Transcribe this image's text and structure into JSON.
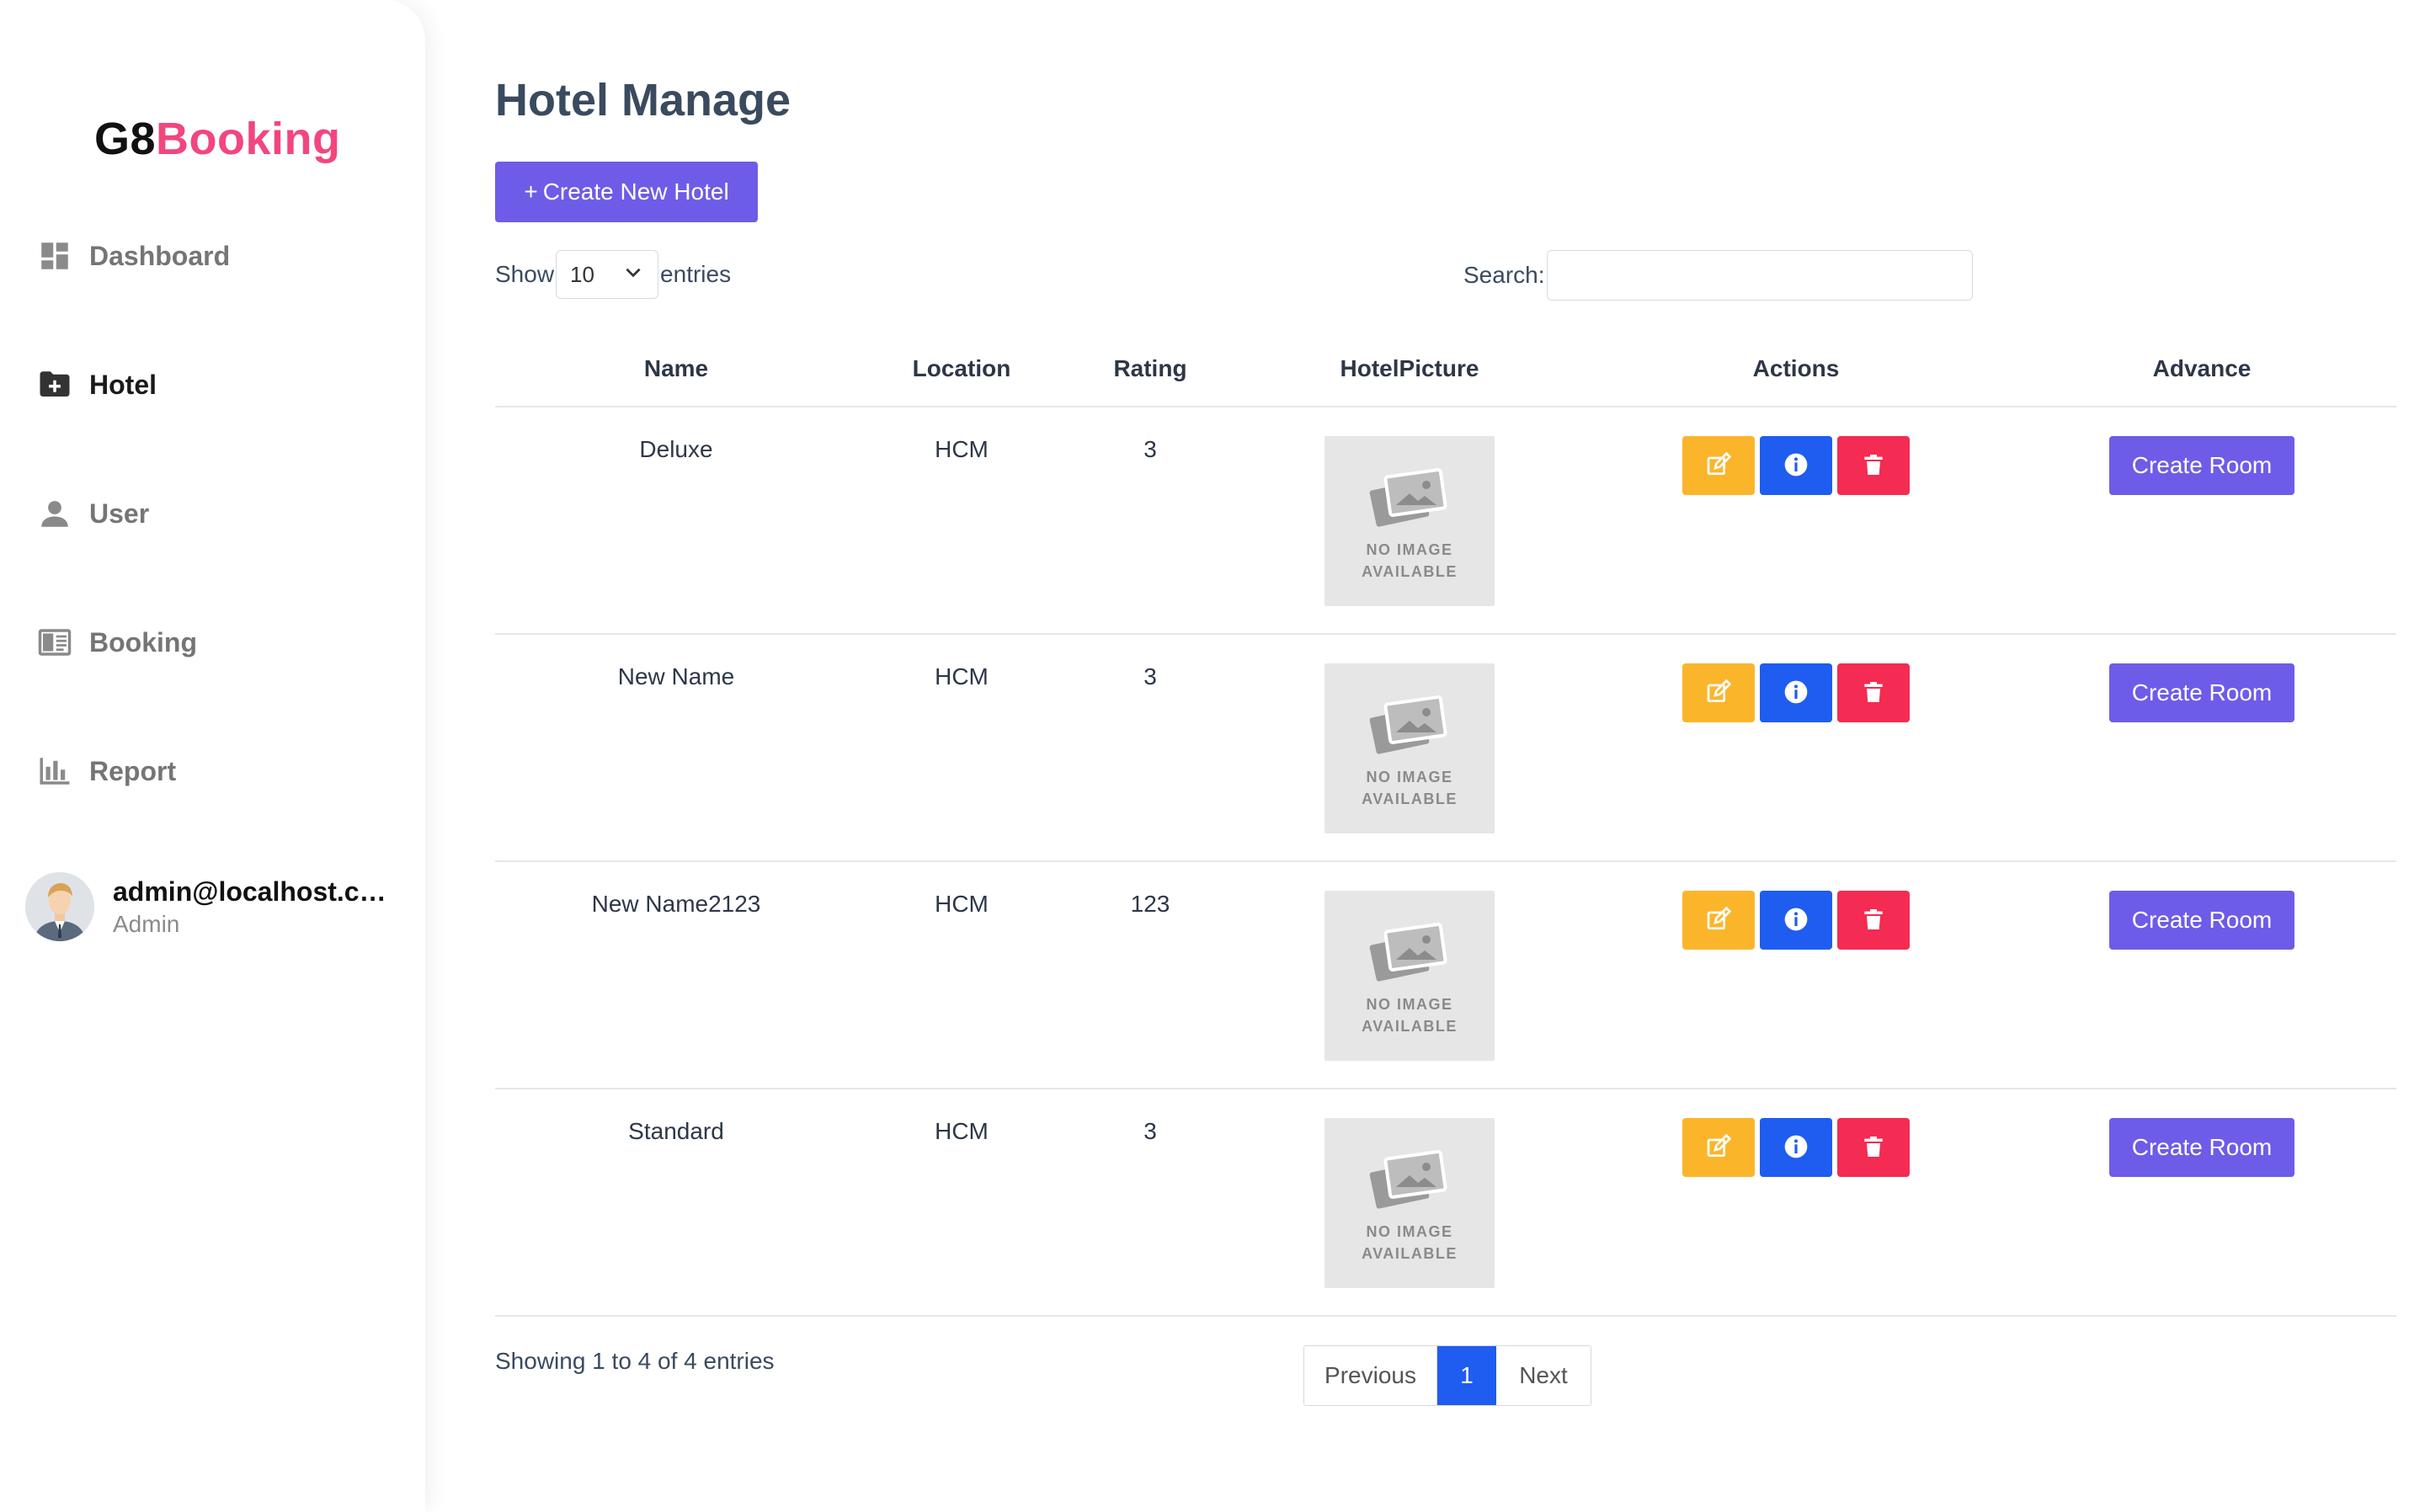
{
  "brand": {
    "part1": "G8",
    "part2": "Booking",
    "color_accent": "#f2467e"
  },
  "sidebar": {
    "items": [
      {
        "label": "Dashboard",
        "icon": "dashboard-icon",
        "active": false
      },
      {
        "label": "Hotel",
        "icon": "folder-plus-icon",
        "active": true
      },
      {
        "label": "User",
        "icon": "user-icon",
        "active": false
      },
      {
        "label": "Booking",
        "icon": "book-icon",
        "active": false
      },
      {
        "label": "Report",
        "icon": "bar-chart-icon",
        "active": false
      }
    ],
    "profile": {
      "email": "admin@localhost.co...",
      "role": "Admin"
    }
  },
  "main": {
    "title": "Hotel Manage",
    "create_button": {
      "plus": "+",
      "label": "Create New Hotel"
    },
    "length": {
      "show_label": "Show",
      "value": "10",
      "entries_label": "entries"
    },
    "search": {
      "label": "Search:",
      "value": ""
    },
    "table": {
      "headers": [
        "Name",
        "Location",
        "Rating",
        "HotelPicture",
        "Actions",
        "Advance"
      ],
      "rows": [
        {
          "name": "Deluxe",
          "location": "HCM",
          "rating": "3"
        },
        {
          "name": "New Name",
          "location": "HCM",
          "rating": "3"
        },
        {
          "name": "New Name2123",
          "location": "HCM",
          "rating": "123"
        },
        {
          "name": "Standard",
          "location": "HCM",
          "rating": "3"
        }
      ],
      "no_image_line1": "NO IMAGE",
      "no_image_line2": "AVAILABLE",
      "advance_button": "Create Room"
    },
    "info": "Showing 1 to 4 of 4 entries",
    "pagination": {
      "previous": "Previous",
      "current": "1",
      "next": "Next"
    }
  },
  "colors": {
    "primary": "#6d5ce8",
    "edit": "#fbb52b",
    "info": "#1f5cf0",
    "delete": "#f42b52",
    "page_active": "#1f5cf0"
  }
}
